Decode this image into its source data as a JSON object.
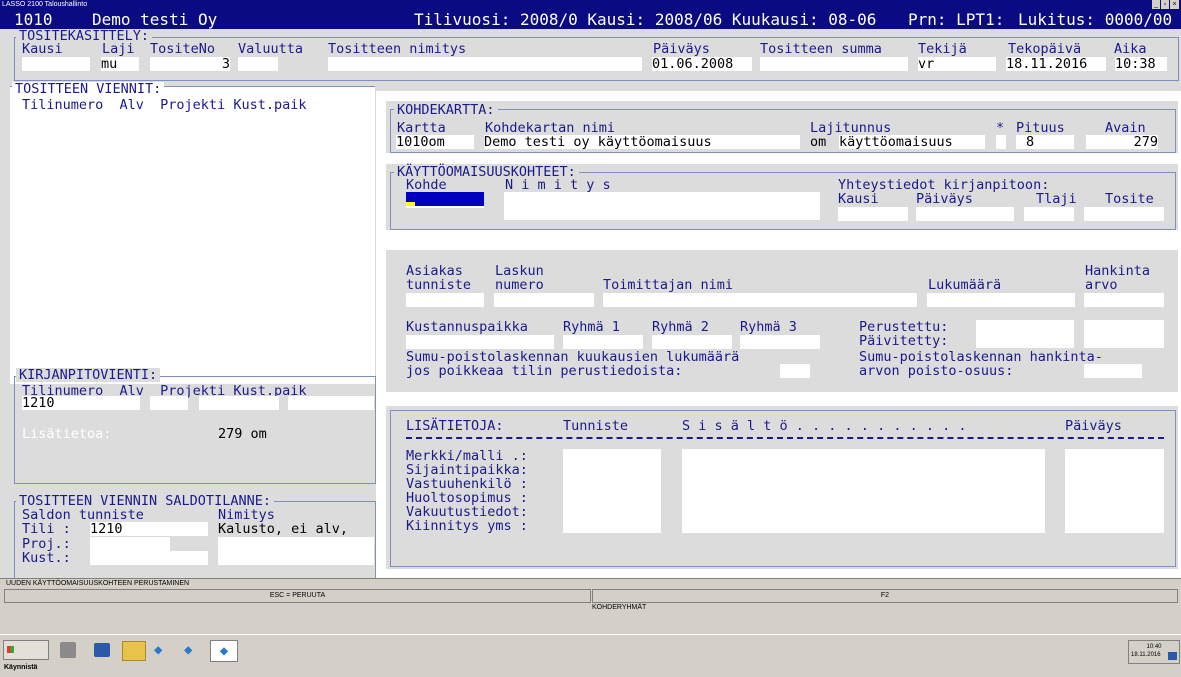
{
  "window": {
    "title": "LASSO 2100 Taloushallinto",
    "controls": [
      "_",
      "³",
      "×"
    ]
  },
  "header": {
    "company_code": "1010",
    "company_name": "Demo testi Oy",
    "period_info": "Tilivuosi: 2008/0 Kausi: 2008/06 Kuukausi: 08-06",
    "printer": "Prn: LPT1:",
    "lock": "Lukitus: 0000/00"
  },
  "voucher": {
    "title": "TOSITEKÄSITTELY:",
    "labels": {
      "kausi": "Kausi",
      "laji": "Laji",
      "tositeno": "TositeNo",
      "valuutta": "Valuutta",
      "nimitys": "Tositteen nimitys",
      "paivays": "Päiväys",
      "summa": "Tositteen summa",
      "tekija": "Tekijä",
      "tekopaiva": "Tekopäivä",
      "aika": "Aika"
    },
    "values": {
      "laji": "mu",
      "tositeno": "3",
      "paivays": "01.06.2008",
      "tekija": "vr",
      "tekopaiva": "18.11.2016",
      "aika": "10:38"
    }
  },
  "entries": {
    "title": "TOSITTEEN VIENNIT:",
    "columns": "Tilinumero  Alv  Projekti Kust.paik"
  },
  "ledger": {
    "title": "KIRJANPITOVIENTI:",
    "columns": "Tilinumero  Alv  Projekti Kust.paik",
    "account": "1210",
    "info_label": "Lisätietoa:",
    "info_value": "279 om"
  },
  "balance": {
    "title": "TOSITTEEN VIENNIN SALDOTILANNE:",
    "col1": "Saldon tunniste",
    "col2": "Nimitys",
    "tili_label": "Tili :",
    "tili_value": "1210",
    "tili_name": "Kalusto, ei alv,",
    "proj_label": "Proj.:",
    "kust_label": "Kust.:"
  },
  "target_card": {
    "title": "KOHDEKARTTA:",
    "labels": {
      "kartta": "Kartta",
      "nimi": "Kohdekartan nimi",
      "lajitunnus": "Lajitunnus",
      "star": "*",
      "pituus": "Pituus",
      "avain": "Avain"
    },
    "values": {
      "kartta": "1010om",
      "nimi": "Demo testi oy käyttöomaisuus",
      "laji_code": "om",
      "laji_name": "käyttöomaisuus",
      "pituus": "8",
      "avain": "279"
    }
  },
  "assets": {
    "title": "KÄYTTÖOMAISUUSKOHTEET:",
    "kohde": "Kohde",
    "nimitys": "N i m i t y s",
    "contact_title": "Yhteystiedot kirjanpitoon:",
    "kausi": "Kausi",
    "paivays": "Päiväys",
    "tlaji": "Tlaji",
    "tosite": "Tosite"
  },
  "purchase": {
    "asiakas1": "Asiakas",
    "asiakas2": "tunniste",
    "lasku1": "Laskun",
    "lasku2": "numero",
    "toimittaja": "Toimittajan nimi",
    "lukumaara": "Lukumäärä",
    "hankinta1": "Hankinta",
    "hankinta2": "arvo",
    "kustannus": "Kustannuspaikka",
    "ryhma1": "Ryhmä 1",
    "ryhma2": "Ryhmä 2",
    "ryhma3": "Ryhmä 3",
    "perustettu": "Perustettu:",
    "paivitetty": "Päivitetty:",
    "sumu1": "Sumu-poistolaskennan kuukausien lukumäärä",
    "sumu2": "jos poikkeaa tilin perustiedoista:",
    "sumu3": "Sumu-poistolaskennan hankinta-",
    "sumu4": "arvon poisto-osuus:"
  },
  "extra": {
    "title": "LISÄTIETOJA:",
    "tunniste": "Tunniste",
    "sisalto": "S i s ä l t ö . . . . . . . . . . .",
    "paivays": "Päiväys",
    "rows": [
      "Merkki/malli .:",
      "Sijaintipaikka:",
      "Vastuuhenkilö :",
      "Huoltosopimus :",
      "Vakuutustiedot:",
      "Kiinnitys yms :"
    ]
  },
  "statusbar": {
    "mode": "UUDEN KÄYTTÖOMAISUUSKOHTEEN PERUSTAMINEN",
    "esc": "ESC = PERUUTA",
    "f2": "F2",
    "f2_desc": "KOHDERYHMÄT"
  },
  "taskbar": {
    "start": "Käynnistä",
    "time": "10:40",
    "date": "18.11.2016"
  },
  "colors": {
    "header_bg": "#0a0a82",
    "label": "#1a1a8c",
    "panel": "#dcdcdc",
    "cursor": "#0000c0"
  }
}
